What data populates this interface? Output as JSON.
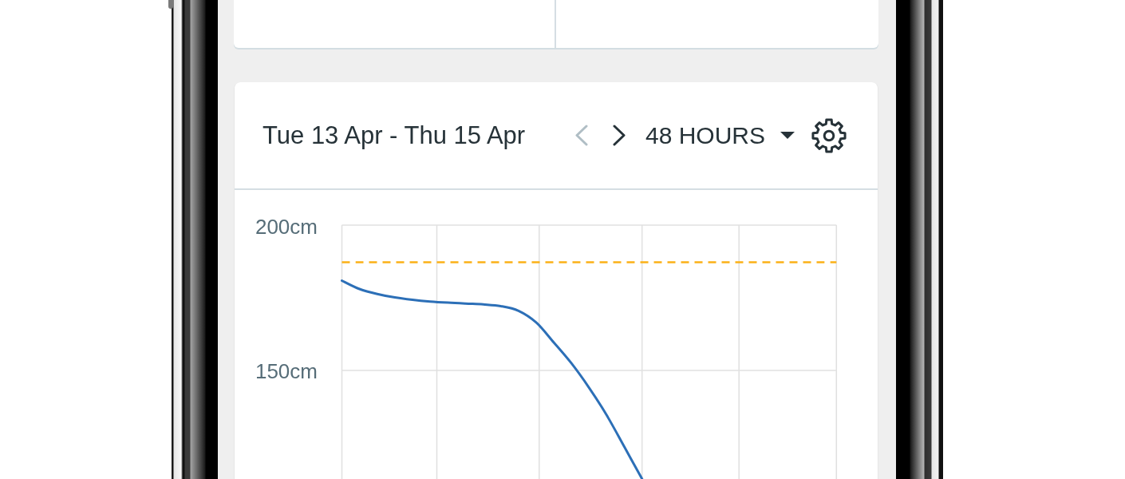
{
  "chart_panel": {
    "date_range": "Tue 13 Apr - Thu 15 Apr",
    "prev_button": {
      "disabled": true
    },
    "next_button": {
      "disabled": false
    },
    "period_select": {
      "value": "48 HOURS"
    },
    "chart_data": {
      "type": "line",
      "categories": [
        null,
        null,
        null,
        null,
        null,
        null,
        null,
        null,
        null,
        null,
        null,
        null,
        null,
        null,
        null,
        null,
        null,
        null,
        null,
        null,
        null,
        null,
        null,
        null,
        null,
        null,
        null,
        null,
        null
      ],
      "ylim": [
        112.6,
        200
      ],
      "yticks": [
        {
          "value": 200,
          "label": "200cm"
        },
        {
          "value": 150,
          "label": "150cm"
        }
      ],
      "series": [
        {
          "color": "#2c6fb7",
          "line_style": "solid",
          "values": [
            180.9,
            178.0,
            176.3,
            175.1,
            174.3,
            173.7,
            173.3,
            173.0,
            172.7,
            172.1,
            170.5,
            166.5,
            159.6,
            152.4,
            144.0,
            134.5,
            123.6,
            112.6,
            null,
            null,
            null,
            null,
            null,
            null,
            null,
            null,
            null,
            null,
            null
          ]
        },
        {
          "color": "#fbb117",
          "line_style": "dashed",
          "values": [
            187.2,
            187.2,
            187.2,
            187.2,
            187.2,
            187.2,
            187.2,
            187.2,
            187.2,
            187.2,
            187.2,
            187.2,
            187.2,
            187.2,
            187.2,
            187.2,
            187.2,
            187.2,
            187.2,
            187.2,
            187.2,
            187.2,
            187.2,
            187.2,
            187.2,
            187.2,
            187.2,
            187.2,
            187.2
          ]
        }
      ]
    }
  }
}
